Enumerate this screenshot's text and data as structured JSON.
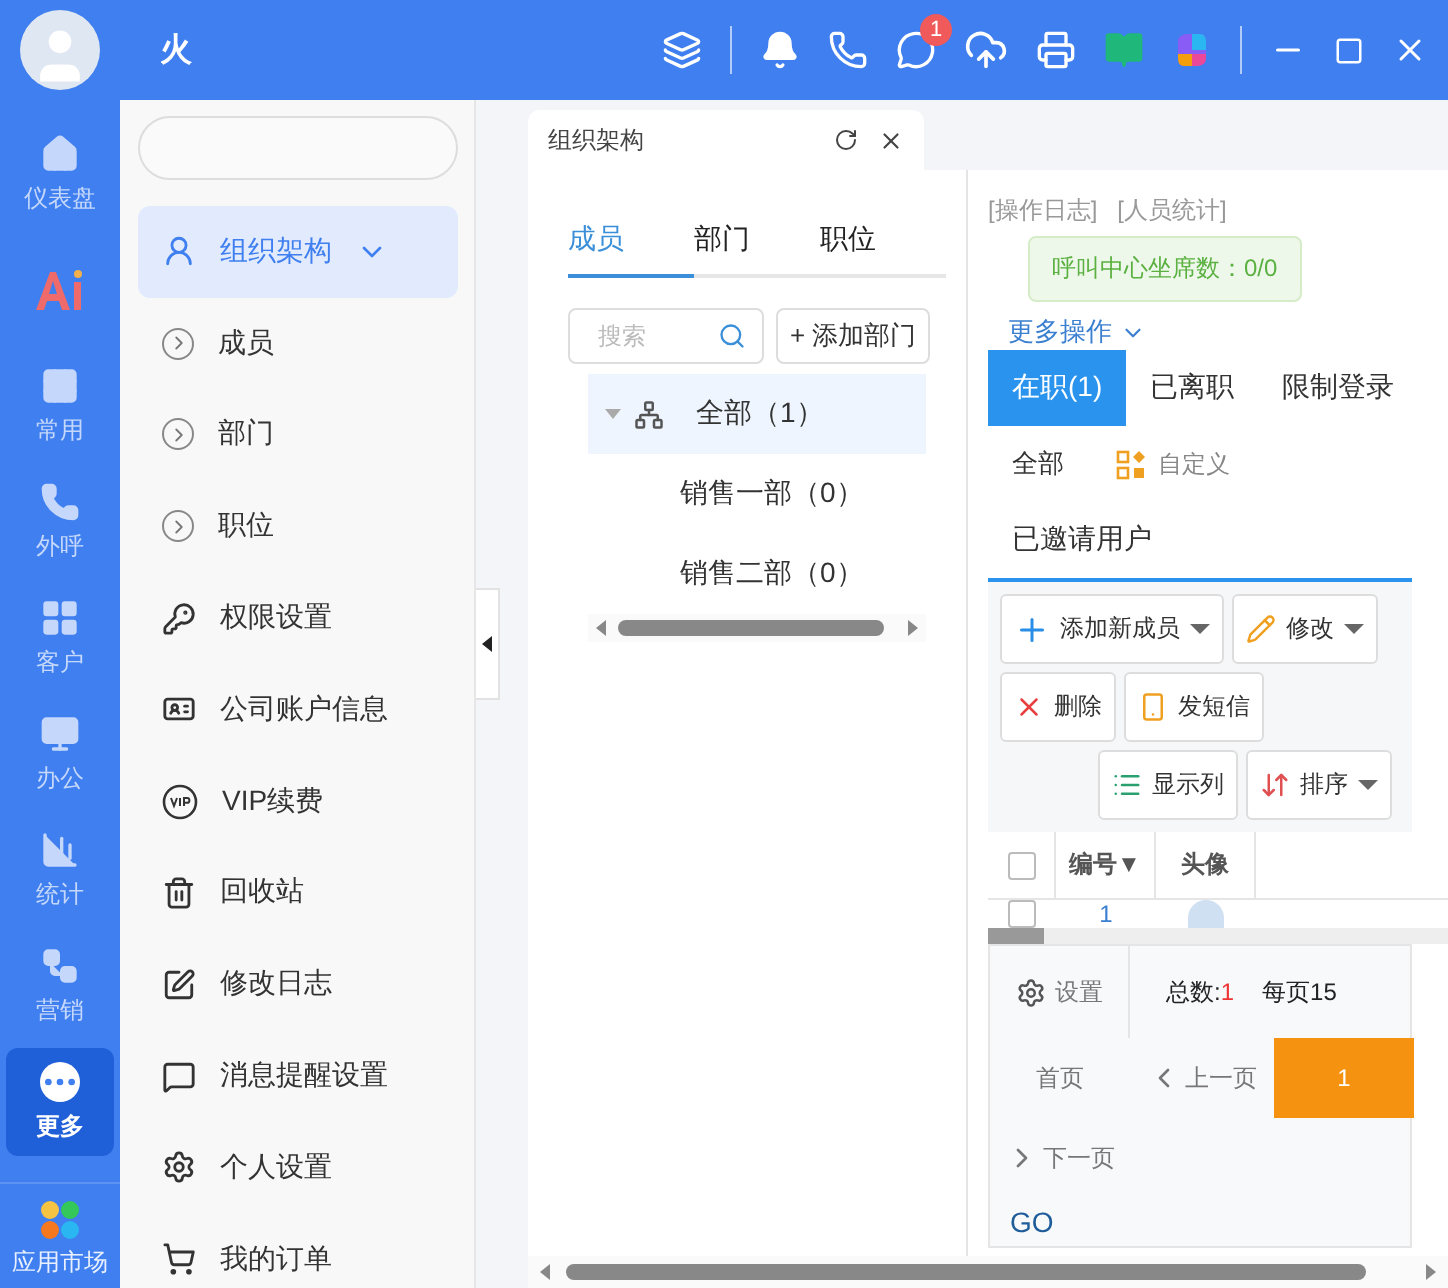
{
  "window": {
    "title": "火",
    "notification_count": "1"
  },
  "rail": [
    {
      "label": "仪表盘",
      "selected": false
    },
    {
      "selected": false
    },
    {
      "label": "常用",
      "selected": false
    },
    {
      "label": "外呼",
      "selected": false
    },
    {
      "label": "客户",
      "selected": false
    },
    {
      "label": "办公",
      "selected": false
    },
    {
      "label": "统计",
      "selected": false
    },
    {
      "label": "营销",
      "selected": false
    },
    {
      "label": "更多",
      "selected": true
    }
  ],
  "rail_bottom": {
    "label": "应用市场"
  },
  "sidebar": {
    "items": [
      {
        "label": "组织架构",
        "kind": "group",
        "expanded": true,
        "selected": true
      },
      {
        "label": "成员",
        "kind": "sub",
        "selected": false
      },
      {
        "label": "部门",
        "kind": "sub",
        "selected": false
      },
      {
        "label": "职位",
        "kind": "sub",
        "selected": false
      },
      {
        "label": "权限设置",
        "kind": "item",
        "selected": false
      },
      {
        "label": "公司账户信息",
        "kind": "item",
        "selected": false
      },
      {
        "label": "VIP续费",
        "kind": "item",
        "selected": false
      },
      {
        "label": "回收站",
        "kind": "item",
        "selected": false
      },
      {
        "label": "修改日志",
        "kind": "item",
        "selected": false
      },
      {
        "label": "消息提醒设置",
        "kind": "item",
        "selected": false
      },
      {
        "label": "个人设置",
        "kind": "item",
        "selected": false
      },
      {
        "label": "我的订单",
        "kind": "item",
        "selected": false
      }
    ]
  },
  "doc_tab": {
    "title": "组织架构"
  },
  "org_tabs": [
    {
      "label": "成员",
      "selected": true
    },
    {
      "label": "部门",
      "selected": false
    },
    {
      "label": "职位",
      "selected": false
    }
  ],
  "search": {
    "placeholder": "搜索"
  },
  "add_dept": "+ 添加部门",
  "tree": [
    {
      "label": "全部（1）",
      "selected": true,
      "expanded": true,
      "children": [
        {
          "label": "销售一部（0）",
          "selected": false
        },
        {
          "label": "销售二部（0）",
          "selected": false
        }
      ]
    }
  ],
  "links": [
    "[操作日志]",
    "[人员统计]"
  ],
  "call_seats": "呼叫中心坐席数：0/0",
  "more_ops": "更多操作",
  "status_tabs": [
    {
      "label": "在职(1)",
      "selected": true
    },
    {
      "label": "已离职",
      "selected": false
    },
    {
      "label": "限制登录",
      "selected": false
    }
  ],
  "filter_all": "全部",
  "customize": "自定义",
  "invited": "已邀请用户",
  "toolbar": [
    {
      "label": "添加新成员",
      "dropdown": true
    },
    {
      "label": "修改",
      "dropdown": true
    },
    {
      "label": "删除",
      "dropdown": false
    },
    {
      "label": "发短信",
      "dropdown": false
    },
    {
      "label": "显示列",
      "dropdown": false
    },
    {
      "label": "排序",
      "dropdown": true
    }
  ],
  "table": {
    "columns": [
      "编号▼",
      "头像"
    ],
    "rows": [
      {
        "checked": false,
        "cells": [
          "1"
        ]
      }
    ],
    "header_checked": false
  },
  "pager": {
    "settings": "设置",
    "total_label": "总数:",
    "total_value": "1",
    "per_page": "每页15",
    "first": "首页",
    "prev": "上一页",
    "pages": [
      {
        "label": "1",
        "selected": true
      }
    ],
    "next": "下一页",
    "go": "GO"
  }
}
